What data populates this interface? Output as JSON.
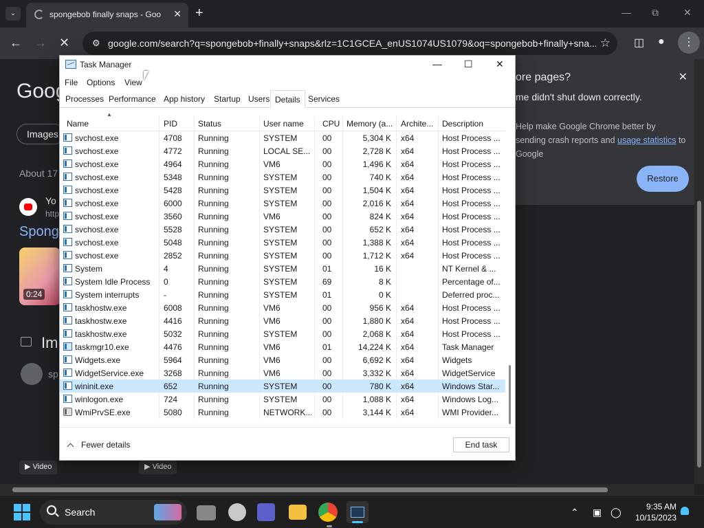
{
  "browser": {
    "tab_title": "spongebob finally snaps - Goo",
    "url": "google.com/search?q=spongebob+finally+snaps&rlz=1C1GCEA_enUS1074US1079&oq=spongebob+finally+sna..."
  },
  "google": {
    "logo_fragment": "Goog",
    "chip_images": "Images",
    "about": "About 17",
    "result_source": "Yo",
    "result_url": "http",
    "result_title": "Spong",
    "video_duration": "0:24",
    "section_images": "Im",
    "suggest_fragment": "sp",
    "video_label_1": "Video",
    "video_label_2": "Video"
  },
  "restore": {
    "title": "ore pages?",
    "message": "me didn't shut down correctly.",
    "checkbox_text_1": "Help make Google Chrome better by sending crash reports and ",
    "checkbox_link": "usage statistics",
    "checkbox_text_2": " to Google",
    "button": "Restore"
  },
  "task_manager": {
    "title": "Task Manager",
    "menu": [
      "File",
      "Options",
      "View"
    ],
    "tabs": [
      "Processes",
      "Performance",
      "App history",
      "Startup",
      "Users",
      "Details",
      "Services"
    ],
    "active_tab": "Details",
    "columns": [
      "Name",
      "PID",
      "Status",
      "User name",
      "CPU",
      "Memory (a...",
      "Archite...",
      "Description"
    ],
    "rows": [
      [
        "svchost.exe",
        "4708",
        "Running",
        "SYSTEM",
        "00",
        "5,304 K",
        "x64",
        "Host Process ..."
      ],
      [
        "svchost.exe",
        "4772",
        "Running",
        "LOCAL SE...",
        "00",
        "2,728 K",
        "x64",
        "Host Process ..."
      ],
      [
        "svchost.exe",
        "4964",
        "Running",
        "VM6",
        "00",
        "1,496 K",
        "x64",
        "Host Process ..."
      ],
      [
        "svchost.exe",
        "5348",
        "Running",
        "SYSTEM",
        "00",
        "740 K",
        "x64",
        "Host Process ..."
      ],
      [
        "svchost.exe",
        "5428",
        "Running",
        "SYSTEM",
        "00",
        "1,504 K",
        "x64",
        "Host Process ..."
      ],
      [
        "svchost.exe",
        "6000",
        "Running",
        "SYSTEM",
        "00",
        "2,016 K",
        "x64",
        "Host Process ..."
      ],
      [
        "svchost.exe",
        "3560",
        "Running",
        "VM6",
        "00",
        "824 K",
        "x64",
        "Host Process ..."
      ],
      [
        "svchost.exe",
        "5528",
        "Running",
        "SYSTEM",
        "00",
        "652 K",
        "x64",
        "Host Process ..."
      ],
      [
        "svchost.exe",
        "5048",
        "Running",
        "SYSTEM",
        "00",
        "1,388 K",
        "x64",
        "Host Process ..."
      ],
      [
        "svchost.exe",
        "2852",
        "Running",
        "SYSTEM",
        "00",
        "1,712 K",
        "x64",
        "Host Process ..."
      ],
      [
        "System",
        "4",
        "Running",
        "SYSTEM",
        "01",
        "16 K",
        "",
        "NT Kernel & ..."
      ],
      [
        "System Idle Process",
        "0",
        "Running",
        "SYSTEM",
        "69",
        "8 K",
        "",
        "Percentage of..."
      ],
      [
        "System interrupts",
        "-",
        "Running",
        "SYSTEM",
        "01",
        "0 K",
        "",
        "Deferred proc..."
      ],
      [
        "taskhostw.exe",
        "6008",
        "Running",
        "VM6",
        "00",
        "956 K",
        "x64",
        "Host Process ..."
      ],
      [
        "taskhostw.exe",
        "4416",
        "Running",
        "VM6",
        "00",
        "1,880 K",
        "x64",
        "Host Process ..."
      ],
      [
        "taskhostw.exe",
        "5032",
        "Running",
        "SYSTEM",
        "00",
        "2,068 K",
        "x64",
        "Host Process ..."
      ],
      [
        "taskmgr10.exe",
        "4476",
        "Running",
        "VM6",
        "01",
        "14,224 K",
        "x64",
        "Task Manager"
      ],
      [
        "Widgets.exe",
        "5964",
        "Running",
        "VM6",
        "00",
        "6,692 K",
        "x64",
        "Widgets"
      ],
      [
        "WidgetService.exe",
        "3268",
        "Running",
        "VM6",
        "00",
        "3,332 K",
        "x64",
        "WidgetService"
      ],
      [
        "wininit.exe",
        "652",
        "Running",
        "SYSTEM",
        "00",
        "780 K",
        "x64",
        "Windows Star..."
      ],
      [
        "winlogon.exe",
        "724",
        "Running",
        "SYSTEM",
        "00",
        "1,088 K",
        "x64",
        "Windows Log..."
      ],
      [
        "WmiPrvSE.exe",
        "5080",
        "Running",
        "NETWORK...",
        "00",
        "3,144 K",
        "x64",
        "WMI Provider..."
      ]
    ],
    "selected_row": 19,
    "fewer_details": "Fewer details",
    "end_task": "End task"
  },
  "taskbar": {
    "search_label": "Search",
    "time": "9:35 AM",
    "date": "10/15/2023"
  },
  "colors": {
    "selection": "#cce8ff",
    "accent": "#4cc2ff",
    "chrome_link": "#8ab4f8"
  }
}
